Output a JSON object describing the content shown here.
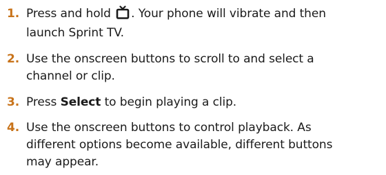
{
  "steps": [
    {
      "number": "1.",
      "text_before_icon": "Press and hold",
      "icon": "tv-icon",
      "text_after_icon": ". Your phone will vibrate and then",
      "line2": "launch Sprint TV."
    },
    {
      "number": "2.",
      "line1": "Use the onscreen buttons to scroll to and select a",
      "line2": "channel or clip."
    },
    {
      "number": "3.",
      "text_before_bold": "Press",
      "bold": "Select",
      "text_after_bold": "to begin playing a clip."
    },
    {
      "number": "4.",
      "line1": "Use the onscreen buttons to control playback. As",
      "line2": "different options become available, different buttons",
      "line3": "may appear."
    }
  ],
  "colors": {
    "step_number": "#c8731a",
    "text": "#1a1a1a"
  }
}
